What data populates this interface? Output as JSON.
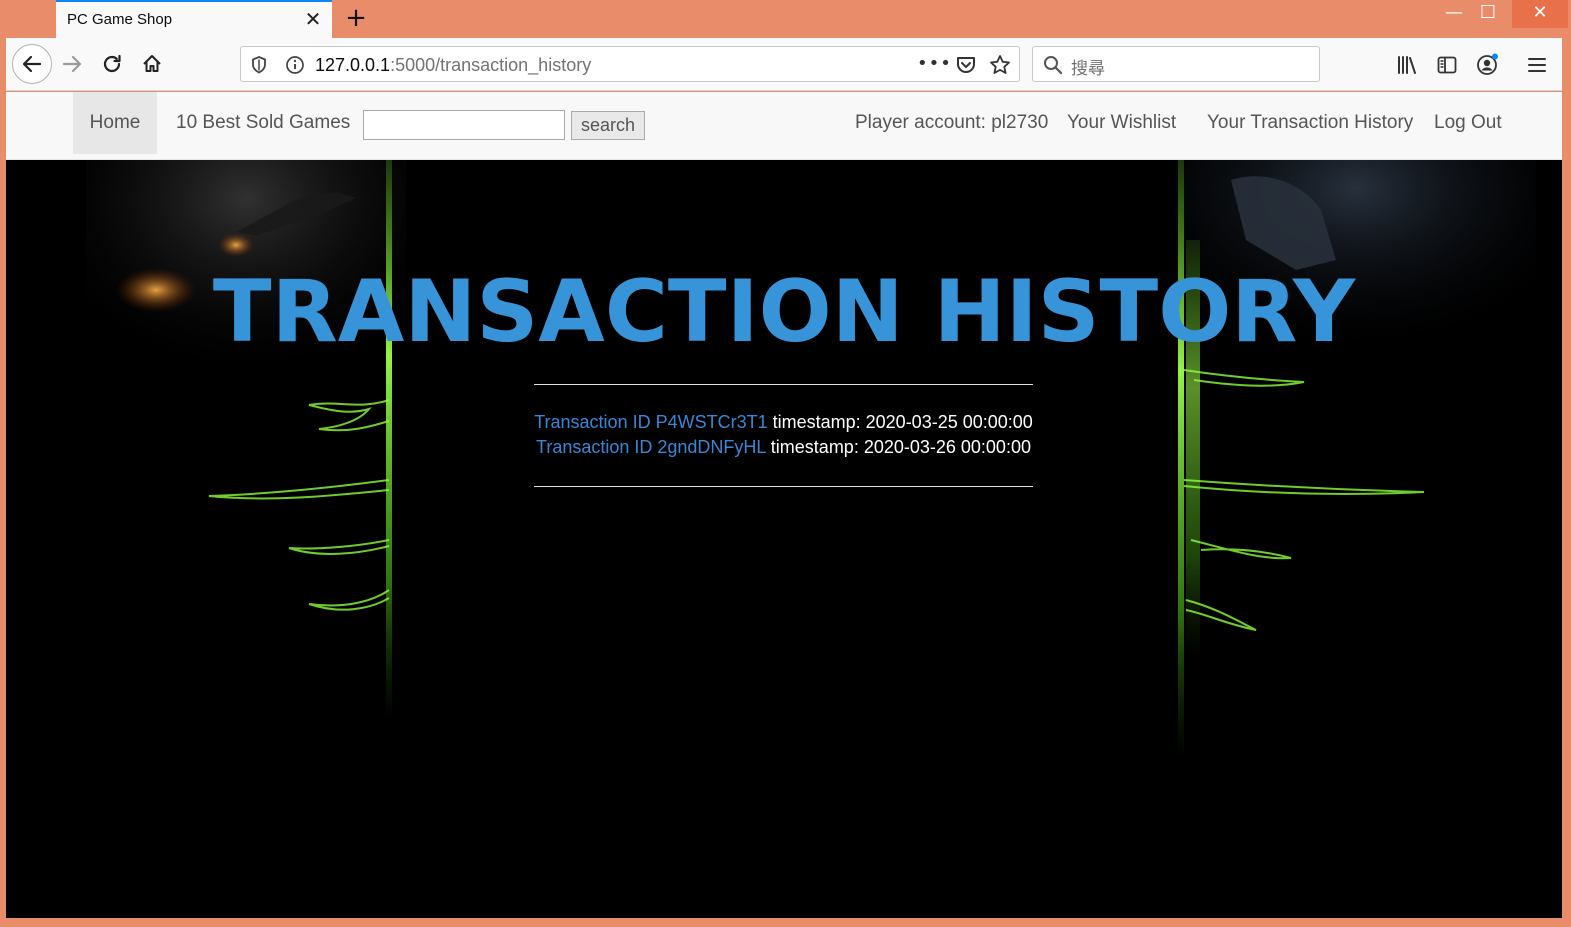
{
  "browser": {
    "tab_title": "PC Game Shop",
    "tab_close_glyph": "✕",
    "new_tab_glyph": "+",
    "url_host": "127.0.0.1",
    "url_rest": ":5000/transaction_history",
    "url_more_glyph": "•••",
    "search_placeholder": "搜尋",
    "window_controls": {
      "minimize": "—",
      "maximize": "☐",
      "close": "✕"
    }
  },
  "site_nav": {
    "home": "Home",
    "best_sold": "10 Best Sold Games",
    "search_input_value": "",
    "search_button": "search",
    "account": "Player account: pl2730",
    "wishlist": "Your Wishlist",
    "transaction_history": "Your Transaction History",
    "logout": "Log Out"
  },
  "main": {
    "title": "TRANSACTION HISTORY",
    "transactions": [
      {
        "link_text": "Transaction ID P4WSTCr3T1",
        "timestamp_text": "timestamp: 2020-03-25 00:00:00"
      },
      {
        "link_text": "Transaction ID 2gndDNFyHL",
        "timestamp_text": "timestamp: 2020-03-26 00:00:00"
      }
    ]
  },
  "colors": {
    "accent": "#3894d8",
    "link": "#3a86d6",
    "window_frame": "#e98c69",
    "page_background": "#000000",
    "glow_green": "#7dfc2a"
  }
}
